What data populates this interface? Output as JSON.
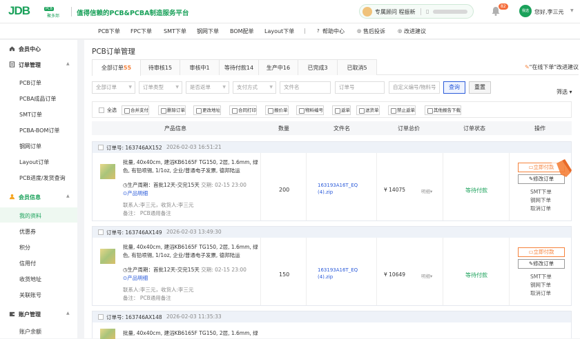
{
  "brand": {
    "logo": "JDB",
    "tag": "PCB",
    "logo_cn": "聚多邦",
    "slogan": "值得信赖的PCB&PCBA制造服务平台",
    "color": "#1aa15a",
    "accent": "#f5813a",
    "link": "#2a5ad9"
  },
  "advisor": {
    "label": "专属顾问 程振新"
  },
  "notify": {
    "count": "82"
  },
  "user": {
    "avatar": "我选",
    "greeting": "您好,李三元"
  },
  "nav": [
    "PCB下单",
    "FPC下单",
    "SMT下单",
    "钢网下单",
    "BOM配单",
    "Layout下单",
    "帮助中心",
    "售后投诉",
    "改进建议"
  ],
  "sidebar": {
    "member": "会员中心",
    "order_group": "订单管理",
    "order_items": [
      "PCB订单",
      "PCBA成品订单",
      "SMT订单",
      "PCBA-BOM订单",
      "钢网订单",
      "Layout订单",
      "PCB进度/发货查询"
    ],
    "info_group": "会员信息",
    "info_items": [
      "我的资料",
      "优惠券",
      "积分",
      "信用付",
      "收货地址",
      "关联账号"
    ],
    "account_group": "账户管理",
    "account_items": [
      "账户余额"
    ]
  },
  "page": {
    "title": "PCB订单管理"
  },
  "tabs": [
    {
      "label": "全部订单",
      "count": "55"
    },
    {
      "label": "待审核15"
    },
    {
      "label": "审核中1"
    },
    {
      "label": "等待付款14"
    },
    {
      "label": "生产中16"
    },
    {
      "label": "已完成3"
    },
    {
      "label": "已取消5"
    }
  ],
  "tabs_hint": {
    "prefix": "\"在线下单\"",
    "suffix": "改进建议"
  },
  "filters": {
    "selects": [
      "全部订单",
      "订单类型",
      "是否返单",
      "支付方式"
    ],
    "inputs": [
      "文件名",
      "订单号",
      "自定义编号/物料号"
    ],
    "query": "查询",
    "reset": "重置",
    "more": "筛选"
  },
  "toolbar": {
    "select_all": "全选",
    "buttons": [
      "合并支付",
      "删除订单",
      "更改地址",
      "合同打印",
      "报价单",
      "物料编号",
      "返单",
      "送货单",
      "禁止返单",
      "其他报告下载"
    ]
  },
  "table": {
    "headers": [
      "产品信息",
      "数量",
      "文件名",
      "订单总价",
      "订单状态",
      "操作"
    ]
  },
  "orders": [
    {
      "no": "订单号: 163746AX152",
      "time": "2026-02-03 16:51:21",
      "desc": "批量, 40x40cm, 建滔KB6165F TG150, 2层, 1.6mm, 绿色, 有铅喷锡, 1/1oz, 企业/普通电子发票, 德邦陆运",
      "cycle": "生产周期：首批12天-交完15天",
      "delivery": "交期: 02-15 23:00",
      "detail": "产品明细",
      "contact": "联系人:李三元，收货人:李三元",
      "note": "备注： PCB通用备注",
      "qty": "200",
      "file": "163193A16T_EQ (4).zip",
      "price": "¥ 14075",
      "mx": "明细",
      "status": "等待付款",
      "pay": "立即付款",
      "modify": "修改订单",
      "links": [
        "SMT下单",
        "钢网下单",
        "取消订单"
      ]
    },
    {
      "no": "订单号: 163746AX149",
      "time": "2026-02-03 13:49:30",
      "desc": "批量, 40x40cm, 建滔KB6165F TG150, 2层, 1.6mm, 绿色, 有铅喷锡, 1/1oz, 企业/普通电子发票, 德邦陆运",
      "cycle": "生产周期：首批12天-交完15天",
      "delivery": "交期: 02-15 23:00",
      "detail": "产品明细",
      "contact": "联系人:李三元，收货人:李三元",
      "note": "备注： PCB通用备注",
      "qty": "150",
      "file": "163193A16T_EQ (4).zip",
      "price": "¥ 10649",
      "mx": "明细",
      "status": "等待付款",
      "pay": "立即付款",
      "modify": "修改订单",
      "links": [
        "SMT下单",
        "钢网下单",
        "取消订单"
      ]
    },
    {
      "no": "订单号: 163746AX148",
      "time": "2026-02-03 11:35:33",
      "desc": "批量, 40x40cm, 建滔KB6165F TG150, 2层, 1.6mm, 绿"
    }
  ]
}
